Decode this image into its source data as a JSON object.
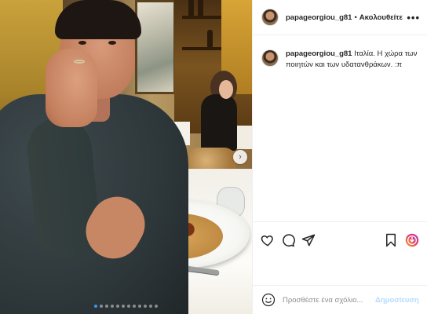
{
  "post": {
    "username": "papageorgiou_g81",
    "separator": "•",
    "follow_label": "Ακολουθείτε",
    "more_label": "•••",
    "caption": {
      "username": "papageorgiou_g81",
      "text": "Ιταλία. Η χώρα των ποιητών και των υδατανθράκων. :π"
    },
    "carousel": {
      "current_index": 1,
      "total": 12,
      "next_label": "›"
    }
  },
  "actions": {
    "like_icon": "heart-icon",
    "comment_icon": "comment-icon",
    "share_icon": "send-icon",
    "save_icon": "bookmark-icon",
    "extra_icon": "badge-icon"
  },
  "comment_box": {
    "emoji_icon": "smiley-icon",
    "placeholder": "Προσθέστε ένα σχόλιο...",
    "post_label": "Δημοσίευση"
  },
  "colors": {
    "link_disabled": "#b3dbff",
    "active_dot": "#3897f0",
    "border": "#efefef",
    "text": "#262626"
  }
}
